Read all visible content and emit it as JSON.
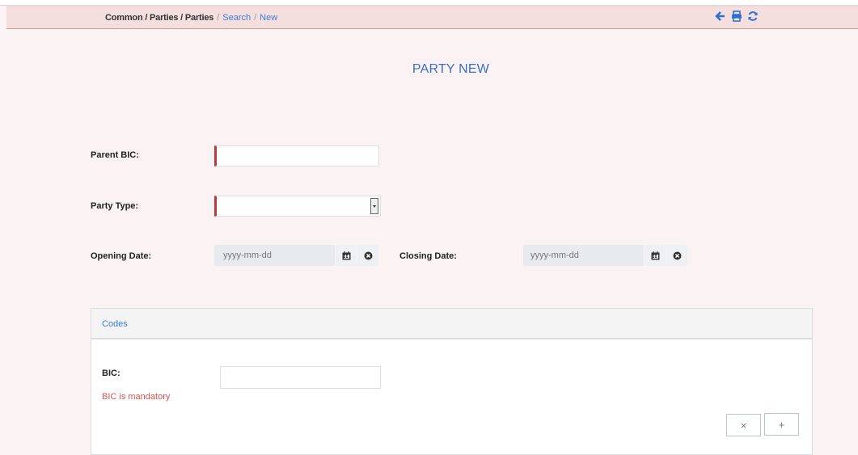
{
  "breadcrumb": {
    "items": [
      "Common / Parties / Parties",
      "Search",
      "New"
    ],
    "separator": "/"
  },
  "toolbar_icons": [
    "back-arrow-icon",
    "print-icon",
    "refresh-icon"
  ],
  "page": {
    "title": "PARTY NEW"
  },
  "form": {
    "parent_bic_label": "Parent BIC:",
    "party_type_label": "Party Type:",
    "opening_date_label": "Opening Date:",
    "opening_date_placeholder": "yyyy-mm-dd",
    "closing_date_label": "Closing Date:",
    "closing_date_placeholder": "yyyy-mm-dd"
  },
  "codes": {
    "title": "Codes",
    "bic_label": "BIC:",
    "error": "BIC is mandatory",
    "remove_label": "×",
    "add_label": "+"
  },
  "colors": {
    "accent": "#3b7bd6",
    "required": "#b53a3a",
    "error": "#d9534f",
    "bar_bg": "#f5dede"
  }
}
